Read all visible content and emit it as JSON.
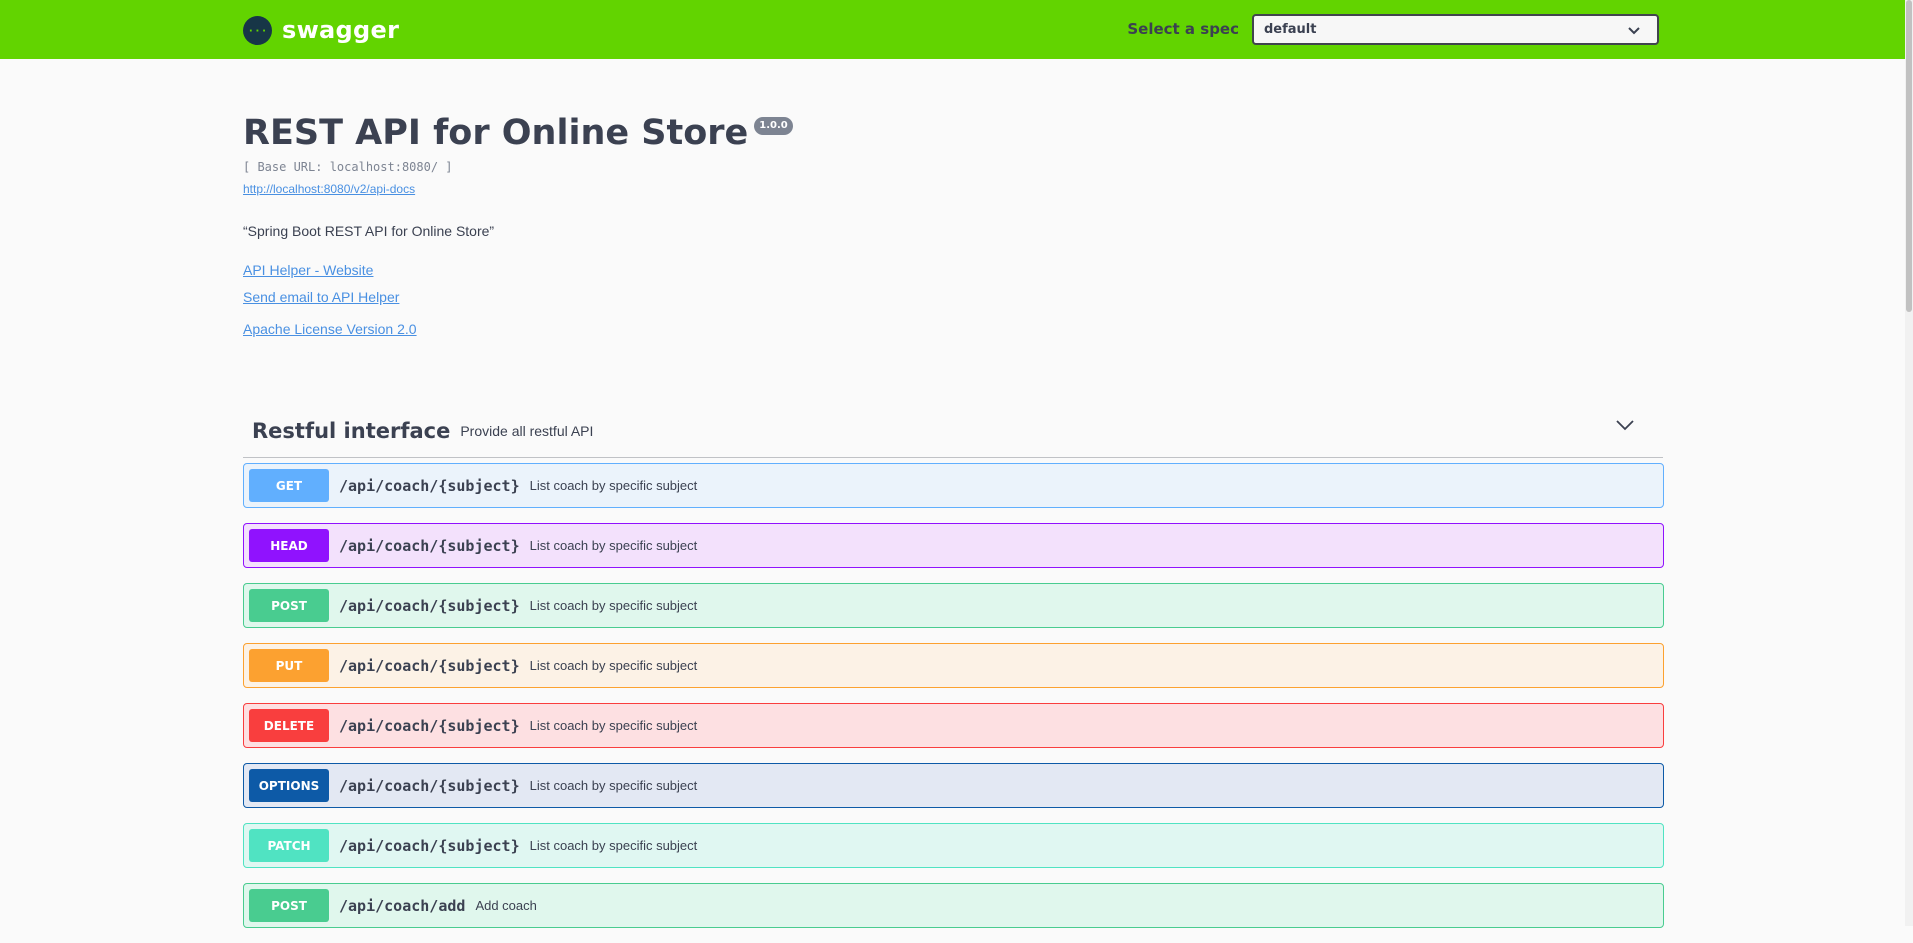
{
  "topbar": {
    "logo_text": "swagger",
    "spec_label": "Select a spec",
    "spec_value": "default",
    "background": "#62d400"
  },
  "info": {
    "title": "REST API for Online Store",
    "version": "1.0.0",
    "base_url": "[ Base URL: localhost:8080/ ]",
    "spec_url": "http://localhost:8080/v2/api-docs",
    "description": "“Spring Boot REST API for Online Store”",
    "links": {
      "website": "API Helper - Website",
      "email": "Send email to API Helper",
      "license": "Apache License Version 2.0"
    }
  },
  "tag": {
    "name": "Restful interface",
    "description": "Provide all restful API"
  },
  "operations": [
    {
      "method": "GET",
      "path": "/api/coach/{subject}",
      "summary": "List coach by specific subject",
      "color": "#61affe",
      "bg": "#ebf3fb"
    },
    {
      "method": "HEAD",
      "path": "/api/coach/{subject}",
      "summary": "List coach by specific subject",
      "color": "#9012fe",
      "bg": "#f3e1fc"
    },
    {
      "method": "POST",
      "path": "/api/coach/{subject}",
      "summary": "List coach by specific subject",
      "color": "#49cc90",
      "bg": "#e0f7ed"
    },
    {
      "method": "PUT",
      "path": "/api/coach/{subject}",
      "summary": "List coach by specific subject",
      "color": "#fca130",
      "bg": "#fcf2e6"
    },
    {
      "method": "DELETE",
      "path": "/api/coach/{subject}",
      "summary": "List coach by specific subject",
      "color": "#f93e3e",
      "bg": "#fde0e2"
    },
    {
      "method": "OPTIONS",
      "path": "/api/coach/{subject}",
      "summary": "List coach by specific subject",
      "color": "#0d5aa7",
      "bg": "#e3e8f3"
    },
    {
      "method": "PATCH",
      "path": "/api/coach/{subject}",
      "summary": "List coach by specific subject",
      "color": "#50e3c2",
      "bg": "#e0f7f2"
    },
    {
      "method": "POST",
      "path": "/api/coach/add",
      "summary": "Add coach",
      "color": "#49cc90",
      "bg": "#e0f7ed"
    }
  ]
}
